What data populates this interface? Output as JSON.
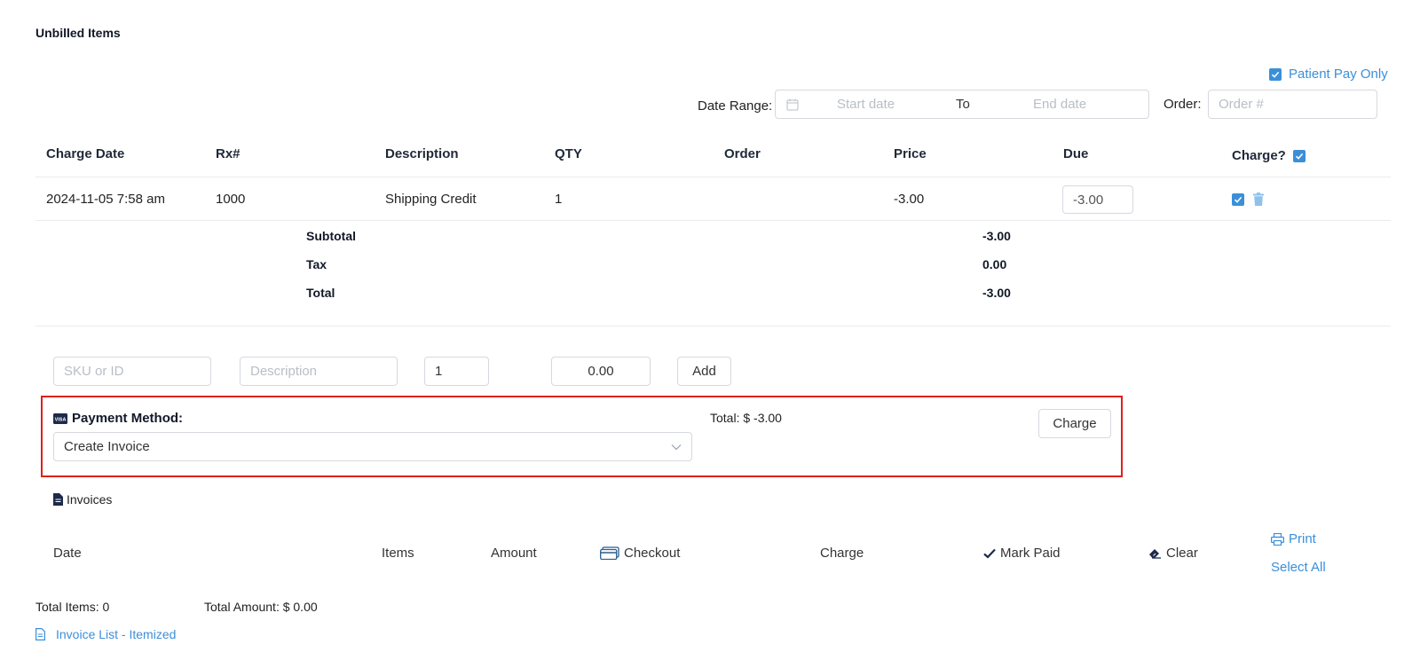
{
  "section_title": "Unbilled Items",
  "patient_pay_only": {
    "label": "Patient Pay Only",
    "checked": true
  },
  "filters": {
    "date_range_label": "Date Range:",
    "start_placeholder": "Start date",
    "to_label": "To",
    "end_placeholder": "End date",
    "order_label": "Order:",
    "order_placeholder": "Order #"
  },
  "table": {
    "headers": [
      "Charge Date",
      "Rx#",
      "Description",
      "QTY",
      "Order",
      "Price",
      "Due",
      "Charge?"
    ],
    "rows": [
      {
        "charge_date": "2024-11-05 7:58 am",
        "rx": "1000",
        "description": "Shipping Credit",
        "qty": "1",
        "order": "",
        "price": "-3.00",
        "due": "-3.00",
        "charge": true
      }
    ]
  },
  "summary": {
    "subtotal_label": "Subtotal",
    "subtotal": "-3.00",
    "tax_label": "Tax",
    "tax": "0.00",
    "total_label": "Total",
    "total": "-3.00"
  },
  "add_item": {
    "sku_placeholder": "SKU or ID",
    "description_placeholder": "Description",
    "qty_value": "1",
    "price_value": "0.00",
    "add_label": "Add"
  },
  "payment": {
    "label": "Payment Method:",
    "selected": "Create Invoice",
    "total_text": "Total: $ -3.00",
    "charge_label": "Charge"
  },
  "invoices": {
    "title": "Invoices",
    "columns": {
      "date": "Date",
      "items": "Items",
      "amount": "Amount",
      "checkout": "Checkout",
      "charge": "Charge",
      "mark_paid": "Mark Paid",
      "clear": "Clear",
      "print": "Print",
      "select_all": "Select All"
    },
    "total_items": "Total Items: 0",
    "total_amount": "Total Amount: $ 0.00",
    "itemized_link": "Invoice List - Itemized"
  },
  "colors": {
    "accent": "#3b8fd9",
    "highlight_border": "#e0201c",
    "text_dark": "#111827"
  }
}
